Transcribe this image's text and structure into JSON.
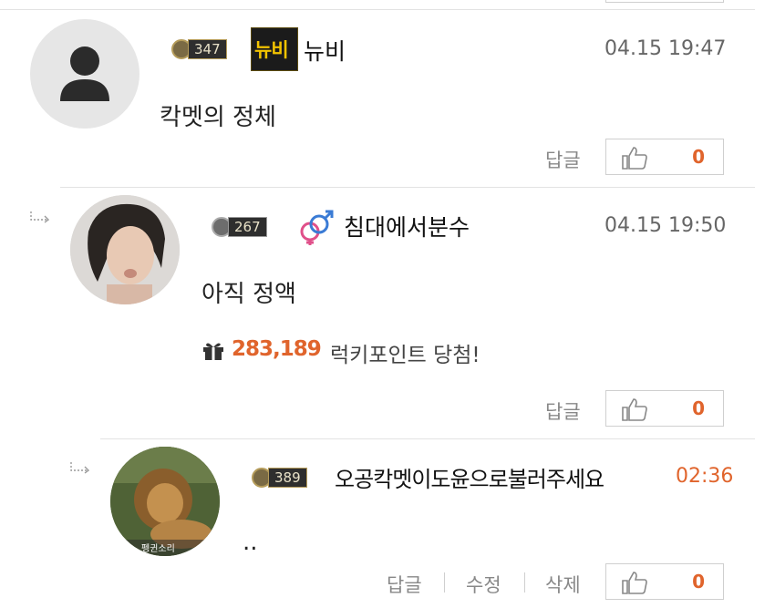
{
  "comments": [
    {
      "level": "347",
      "tag_text": "뉴비",
      "nickname": "뉴비",
      "time": "04.15 19:47",
      "text": "칵멧의 정체",
      "reply_label": "답글",
      "likes": "0"
    },
    {
      "level": "267",
      "nickname": "침대에서분수",
      "time": "04.15 19:50",
      "text": "아직 정액",
      "points_value": "283,189",
      "points_text": "럭키포인트 당첨!",
      "reply_label": "답글",
      "likes": "0"
    },
    {
      "level": "389",
      "nickname": "오공칵멧이도윤으로불러주세요",
      "time": "02:36",
      "text": "..",
      "avatar_caption": "펭귄소리",
      "reply_label": "답글",
      "edit_label": "수정",
      "delete_label": "삭제",
      "likes": "0"
    }
  ],
  "icons": {
    "user": "user-silhouette-icon",
    "gender": "gender-icon",
    "gift": "gift-icon",
    "thumbs_up": "thumbs-up-icon",
    "reply_arrow": "reply-arrow-icon"
  },
  "colors": {
    "accent": "#e0642c",
    "time_recent": "#e0642c"
  }
}
